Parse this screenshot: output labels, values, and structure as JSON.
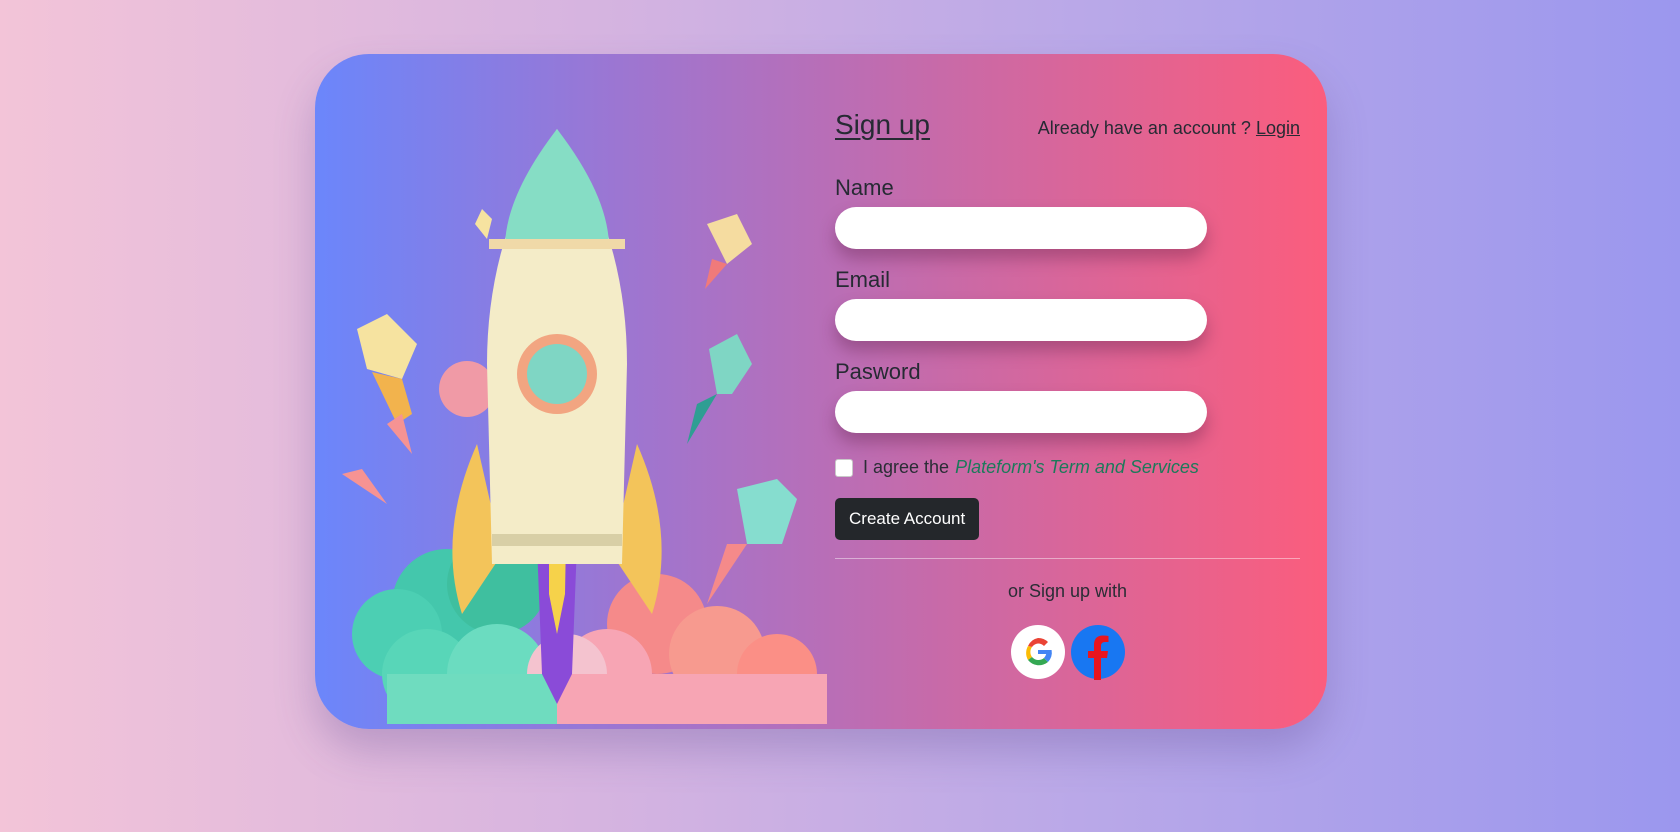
{
  "illustration": {
    "icon": "rocket-illustration"
  },
  "header": {
    "title": "Sign up",
    "already_text": "Already have an account ? ",
    "login_link": "Login"
  },
  "form": {
    "name_label": "Name",
    "name_value": "",
    "email_label": "Email",
    "email_value": "",
    "password_label": "Pasword",
    "password_value": "",
    "agree_text": "I agree the",
    "terms_link": "Plateform's Term and Services",
    "agree_checked": false,
    "create_button": "Create Account"
  },
  "social": {
    "or_text": "or Sign up with",
    "buttons": [
      {
        "icon": "google-icon"
      },
      {
        "icon": "facebook-icon"
      }
    ]
  },
  "colors": {
    "card_start": "#6b86fb",
    "card_end": "#fb5d7d",
    "button_bg": "#24272b",
    "terms_link": "#1c7a5a"
  }
}
